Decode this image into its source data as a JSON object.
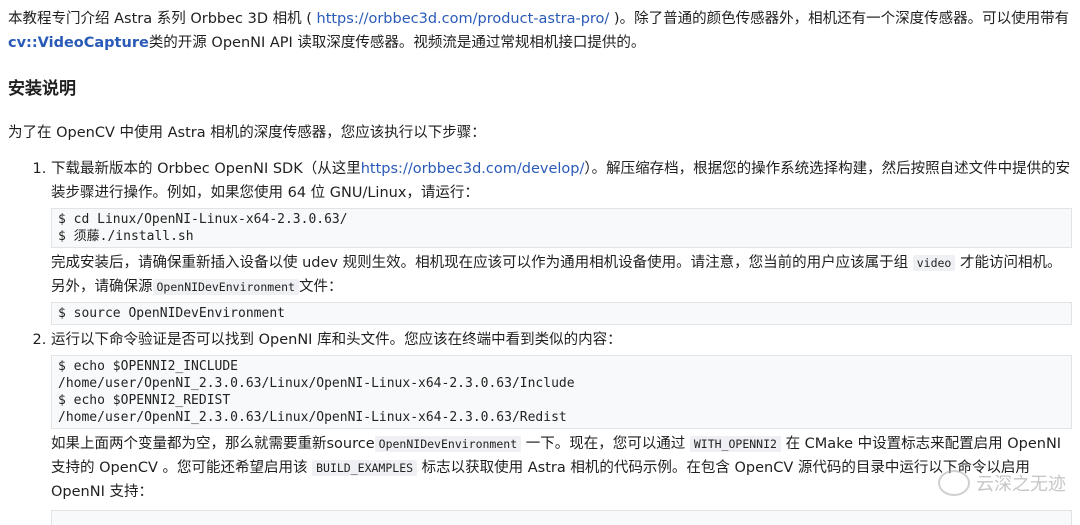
{
  "intro": {
    "text1": "本教程专门介绍 Astra 系列 Orbbec 3D 相机 (",
    "link1": "https://orbbec3d.com/product-astra-pro/",
    "text2": ")。除了普通的颜色传感器外，相机还有一个深度传感器。可以使用带有",
    "class_name": "cv::VideoCapture",
    "text3": "类的开源 OpenNI API 读取深度传感器。视频流是通过常规相机接口提供的。"
  },
  "section": {
    "heading": "安装说明",
    "lead": "为了在 OpenCV 中使用 Astra 相机的深度传感器，您应该执行以下步骤："
  },
  "steps": [
    {
      "text1": "下载最新版本的 Orbbec OpenNI SDK（从这里",
      "link": "https://orbbec3d.com/develop/",
      "text2": "）。解压缩存档，根据您的操作系统选择构建，然后按照自述文件中提供的安装步骤进行操作。例如，如果您使用 64 位 GNU/Linux，请运行：",
      "code1": "$ cd Linux/OpenNI-Linux-x64-2.3.0.63/\n$ 须藤./install.sh",
      "after1": "完成安装后，请确保重新插入设备以使 udev 规则生效。相机现在应该可以作为通用相机设备使用。请注意，您当前的用户应该属于组",
      "code_inline1": "video",
      "after2": "才能访问相机。另外，请确保源",
      "code_inline2": "OpenNIDevEnvironment",
      "after3": "文件：",
      "code2": "$ source OpenNIDevEnvironment"
    },
    {
      "text1": "运行以下命令验证是否可以找到 OpenNI 库和头文件。您应该在终端中看到类似的内容：",
      "code1": "$ echo $OPENNI2_INCLUDE\n/home/user/OpenNI_2.3.0.63/Linux/OpenNI-Linux-x64-2.3.0.63/Include\n$ echo $OPENNI2_REDIST\n/home/user/OpenNI_2.3.0.63/Linux/OpenNI-Linux-x64-2.3.0.63/Redist",
      "after1": "如果上面两个变量都为空，那么就需要重新source",
      "code_inline1": "OpenNIDevEnvironment",
      "after2": "一下。现在，您可以通过",
      "code_inline2": "WITH_OPENNI2",
      "after3": "在 CMake 中设置标志来配置启用 OpenNI 支持的 OpenCV 。您可能还希望启用该",
      "code_inline3": "BUILD_EXAMPLES",
      "after4": "标志以获取使用 Astra 相机的代码示例。在包含 OpenCV 源代码的目录中运行以下命令以启用 OpenNI 支持："
    }
  ],
  "watermark": {
    "text": "云深之无迹"
  }
}
